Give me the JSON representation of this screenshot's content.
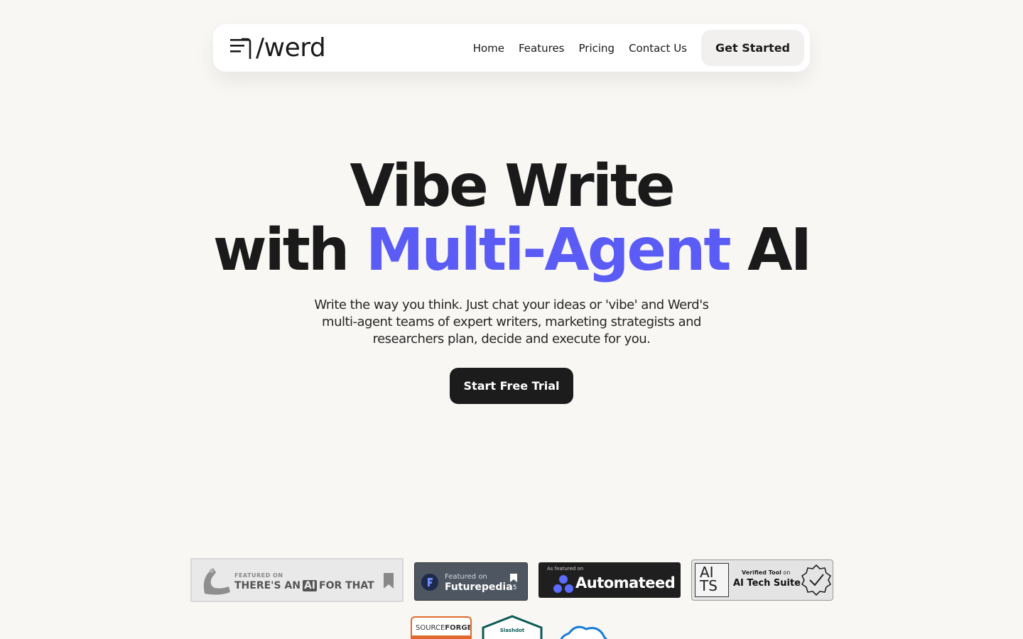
{
  "nav": {
    "logo_text": "/werd",
    "links": [
      "Home",
      "Features",
      "Pricing",
      "Contact Us"
    ],
    "cta": "Get Started"
  },
  "hero": {
    "line1": "Vibe Write",
    "line2_prefix": "with ",
    "line2_accent": "Multi-Agent",
    "line2_suffix": " AI",
    "subtext": "Write the way you think. Just chat your ideas or 'vibe' and Werd's multi-agent teams of expert writers, marketing strategists and researchers plan, decide and execute for you.",
    "cta": "Start Free Trial"
  },
  "badges": {
    "taaft": {
      "top": "FEATURED ON",
      "main_pre": "THERE'S AN",
      "main_ai": "AI",
      "main_post": "FOR THAT"
    },
    "futurepedia": {
      "top": "Featured on",
      "main": "Futurepedia",
      "count": "15"
    },
    "automateed": {
      "top": "As featured on",
      "main": "Automateed"
    },
    "aitechsuite": {
      "logo1": "AI",
      "logo2": "TS",
      "top_bold": "Verified Tool",
      "top_rest": " on",
      "main": "AI Tech Suite"
    },
    "sourceforge": {
      "label_a": "SOURCE",
      "label_b": "FORGE"
    },
    "slashdot": {
      "label": "Slashdot"
    }
  },
  "colors": {
    "accent": "#5b5bf6",
    "background": "#f8f7f4",
    "dark": "#1c1c1c"
  }
}
